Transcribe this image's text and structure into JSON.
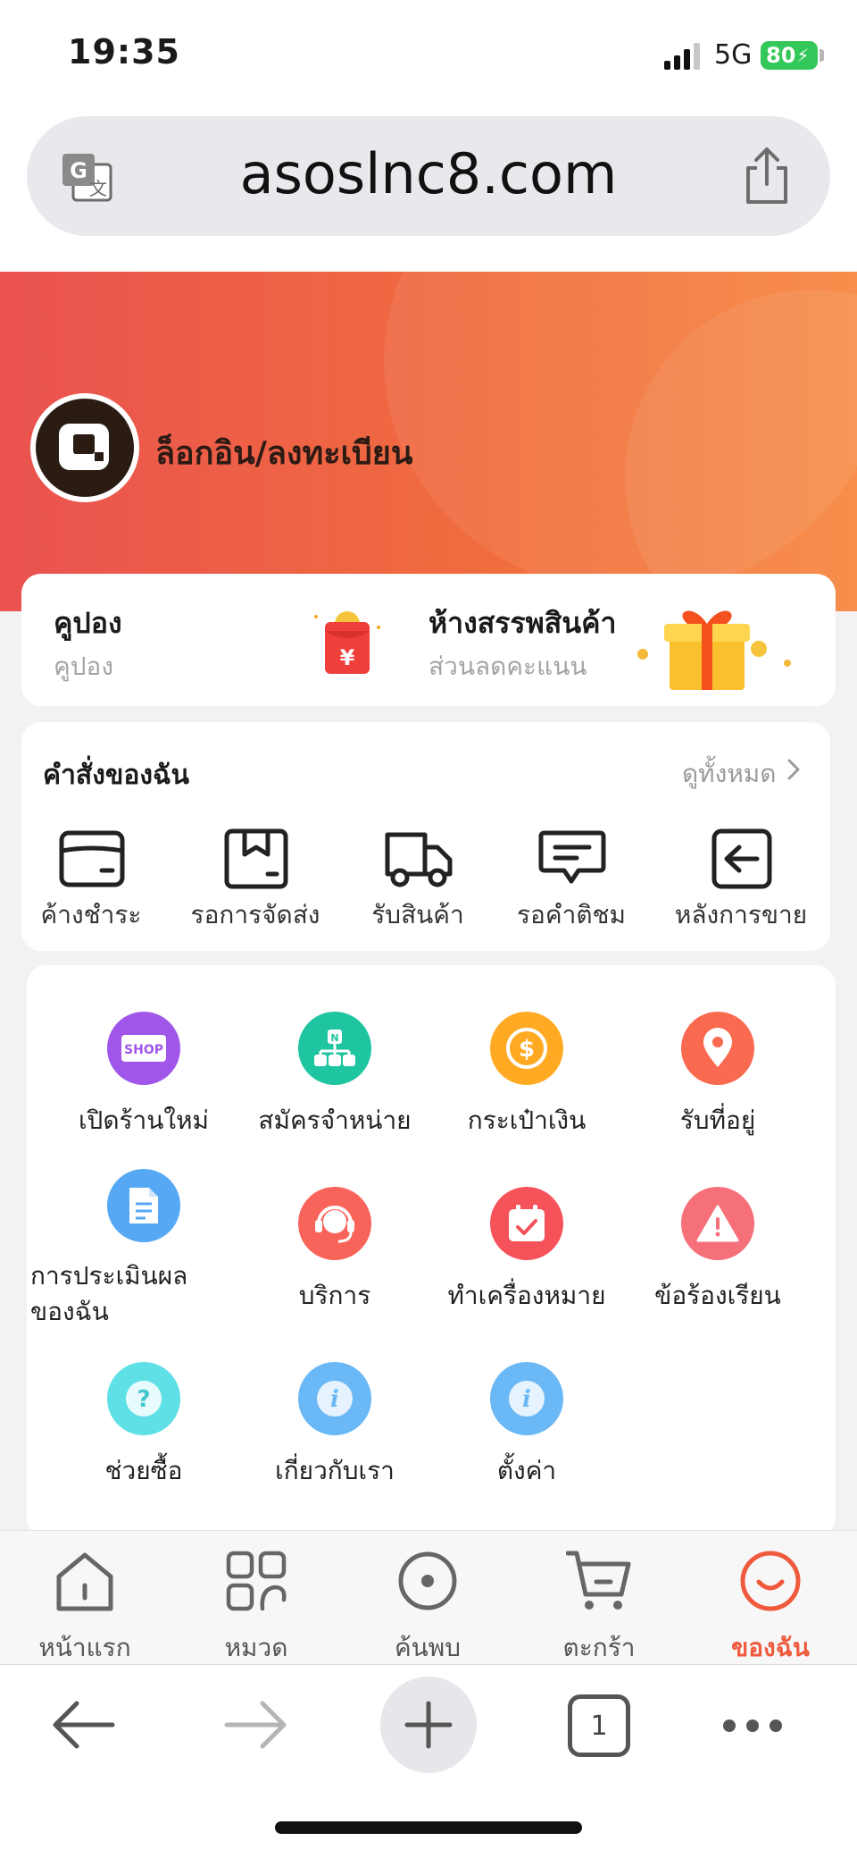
{
  "status_bar": {
    "time": "19:35",
    "network": "5G",
    "battery": "80"
  },
  "browser": {
    "url": "asoslnc8.com",
    "tab_count": "1"
  },
  "header": {
    "login_text": "ล็อกอิน/ลงทะเบียน"
  },
  "promo": {
    "coupon_title": "คูปอง",
    "coupon_sub": "คูปอง",
    "mall_title": "ห้างสรรพสินค้า",
    "mall_sub": "ส่วนลดคะแนน"
  },
  "orders": {
    "title": "คำสั่งของฉัน",
    "view_all": "ดูทั้งหมด",
    "items": [
      {
        "label": "ค้างชำระ",
        "icon": "wallet-icon"
      },
      {
        "label": "รอการจัดส่ง",
        "icon": "package-icon"
      },
      {
        "label": "รับสินค้า",
        "icon": "truck-icon"
      },
      {
        "label": "รอคำติชม",
        "icon": "comment-icon"
      },
      {
        "label": "หลังการขาย",
        "icon": "return-icon"
      }
    ]
  },
  "services": {
    "items": [
      {
        "label": "เปิดร้านใหม่",
        "icon": "shop-icon",
        "color": "#a056e8"
      },
      {
        "label": "สมัครจำหน่าย",
        "icon": "distributor-icon",
        "color": "#1fc4a0"
      },
      {
        "label": "กระเป๋าเงิน",
        "icon": "coin-icon",
        "color": "#ffaa22"
      },
      {
        "label": "รับที่อยู่",
        "icon": "location-icon",
        "color": "#fa6a50"
      },
      {
        "label": "การประเมินผล",
        "label2": "ของฉัน",
        "icon": "document-icon",
        "color": "#56a8f4"
      },
      {
        "label": "บริการ",
        "icon": "customer-service-icon",
        "color": "#f8645a"
      },
      {
        "label": "ทำเครื่องหมาย",
        "icon": "calendar-check-icon",
        "color": "#f5525a"
      },
      {
        "label": "ข้อร้องเรียน",
        "icon": "warning-icon",
        "color": "#f6707a"
      },
      {
        "label": "ช่วยซื้อ",
        "icon": "help-icon",
        "color": "#5fe0e6"
      },
      {
        "label": "เกี่ยวกับเรา",
        "icon": "info-icon",
        "color": "#6ab8f6"
      },
      {
        "label": "ตั้งค่า",
        "icon": "settings-info-icon",
        "color": "#6ab8f6"
      }
    ]
  },
  "tabs": [
    {
      "label": "หน้าแรก",
      "icon": "home-icon"
    },
    {
      "label": "หมวด",
      "icon": "category-icon"
    },
    {
      "label": "ค้นพบ",
      "icon": "discover-icon"
    },
    {
      "label": "ตะกร้า",
      "icon": "cart-icon"
    },
    {
      "label": "ของฉัน",
      "icon": "profile-icon",
      "active": true
    }
  ],
  "colors": {
    "accent": "#ef5a3c",
    "header_start": "#ea5250",
    "header_end": "#f7863e"
  }
}
